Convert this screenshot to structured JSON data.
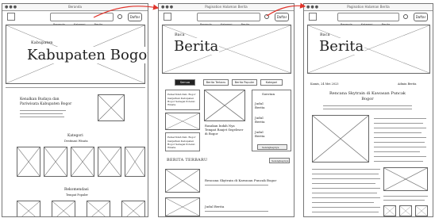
{
  "frame1": {
    "window_title": "Beranda",
    "nav_items": [
      "Beranda",
      "Kategori",
      "Berita",
      "Tentang"
    ],
    "button": "Daftar",
    "hero_small": "Kabupaten",
    "hero_title": "Kabupaten Bogor",
    "section1_title": "Kenalkan Budaya dan Pariwisata Kabupaten Bogor",
    "section2_title": "Kategori",
    "section2_sub": "Destinasi Wisata",
    "section3_title": "Rekomendasi",
    "section3_sub": "Tempat Populer"
  },
  "frame2": {
    "window_title": "Pagination Halaman Berita",
    "nav_items": [
      "Beranda",
      "Kategori",
      "Berita",
      "Tentang"
    ],
    "button": "Daftar",
    "hero_small": "Baca",
    "hero_title": "Berita",
    "tabs": [
      "Semua",
      "Berita Terbaru",
      "Berita Populer",
      "Kategori"
    ],
    "side_card_title": "Pemerintah Kab. Bogor",
    "side_card_text": "Ganjarkan Kabupaten Bogor Sebagai Potensi Wisata",
    "main_card_title": "Rasakan Indah Nya Tempat Ranjet Segeleser di Bogor",
    "sidebar_title": "Sorotan",
    "sidebar_items": [
      "Judul Berita",
      "Judul Berita",
      "Judul Berita"
    ],
    "sidebar_button": "Selengkapnya",
    "latest_title": "BERITA TERBARU",
    "latest_button": "Selengkapnya",
    "list_items": [
      "Rencana Skytrain di Kawasan Puncak Bogor",
      "Judul Berita"
    ]
  },
  "frame3": {
    "window_title": "Pagination Halaman Berita",
    "nav_items": [
      "Beranda",
      "Kategori",
      "Berita",
      "Tentang"
    ],
    "button": "Daftar",
    "hero_small": "Baca",
    "hero_title": "Berita",
    "meta_left": "Kamis, 24 Mei 2023",
    "meta_right": "Admin Berita",
    "article_title": "Rencana Skytrain di Kawasan Puncak Bogor"
  }
}
